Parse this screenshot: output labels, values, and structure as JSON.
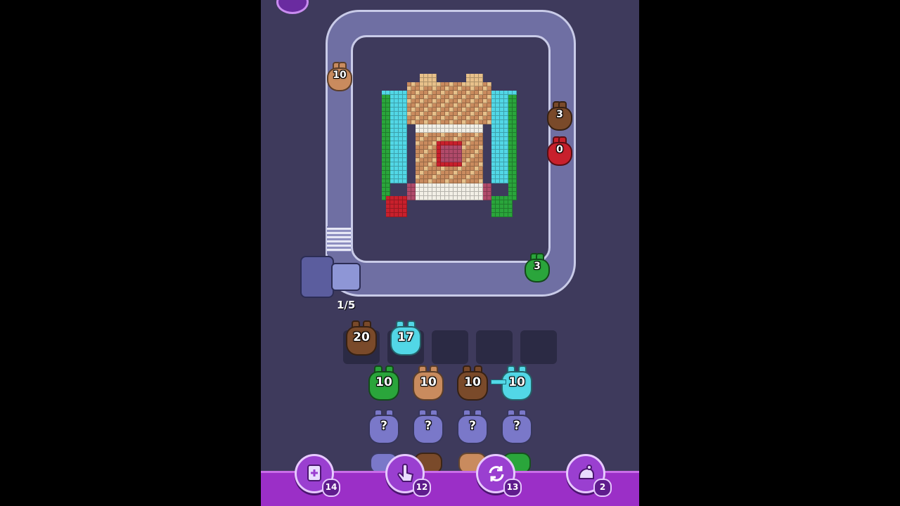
{
  "level_progress": "1/5",
  "colors": {
    "brown": "#7a4a2a",
    "tan": "#c98b5e",
    "cyan": "#52d7e6",
    "green": "#2aa53b",
    "red": "#c8202c",
    "mystery": "#7a78c9",
    "background": "#3e3a5c",
    "powerup_bar": "#9b2fc7"
  },
  "conveyor_pigs": [
    {
      "label": "10",
      "color": "tan"
    },
    {
      "label": "3",
      "color": "brown"
    },
    {
      "label": "0",
      "color": "red"
    },
    {
      "label": "3",
      "color": "green"
    }
  ],
  "holding_slots": [
    {
      "label": "20",
      "color": "brown"
    },
    {
      "label": "17",
      "color": "cyan"
    },
    {
      "label": "",
      "color": "empty"
    },
    {
      "label": "",
      "color": "empty"
    },
    {
      "label": "",
      "color": "empty"
    }
  ],
  "queue_row_1": [
    {
      "label": "10",
      "color": "green"
    },
    {
      "label": "10",
      "color": "tan"
    },
    {
      "label": "10",
      "color": "brown"
    },
    {
      "label": "10",
      "color": "cyan"
    }
  ],
  "queue_row_2": [
    {
      "label": "?",
      "color": "mystery"
    },
    {
      "label": "?",
      "color": "mystery"
    },
    {
      "label": "?",
      "color": "mystery"
    },
    {
      "label": "?",
      "color": "mystery"
    }
  ],
  "powerups": [
    {
      "icon": "add-slot-icon",
      "count": "14"
    },
    {
      "icon": "hand-pick-icon",
      "count": "12"
    },
    {
      "icon": "shuffle-icon",
      "count": "13"
    },
    {
      "icon": "magnet-icon",
      "count": "2"
    }
  ]
}
